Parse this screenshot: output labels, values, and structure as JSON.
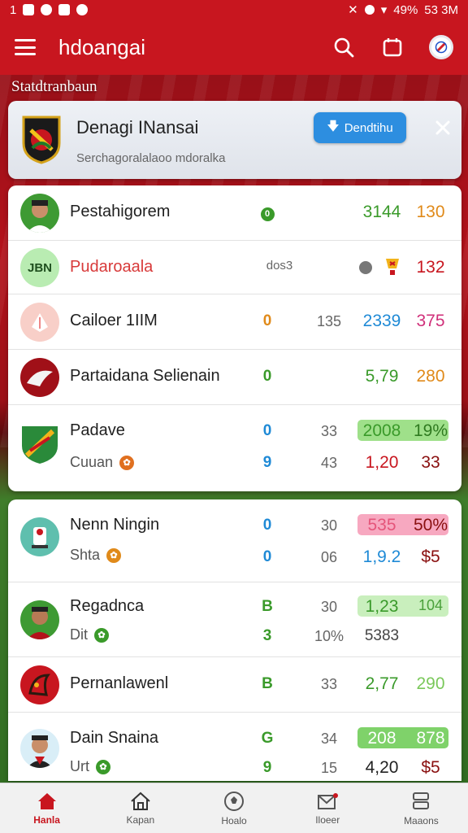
{
  "status_bar": {
    "time": "1",
    "battery": "49%",
    "clock": "53 3M"
  },
  "app": {
    "title": "hdoangai"
  },
  "section_title": "Statdtranbaun",
  "banner": {
    "title": "Denagi INansai",
    "subtitle": "Serchagoralalaoo mdoralka",
    "download_label": "Dendtihu"
  },
  "rows_card1": [
    {
      "name": "Pestahigorem",
      "c1": "0",
      "c3": "3144",
      "c4": "130"
    },
    {
      "avatar_text": "JBN",
      "name": "Pudaroaala",
      "c2": "dos3",
      "c4": "132"
    },
    {
      "name": "Cailoer 1IIM",
      "c1": "0",
      "c2": "135",
      "c3": "2339",
      "c4": "375"
    },
    {
      "name": "Partaidana Selienain",
      "c1": "0",
      "c3": "5,79",
      "c4": "280"
    },
    {
      "name": "Padave",
      "sub": "Cuuan",
      "c1a": "0",
      "c2a": "33",
      "c3a": "2008",
      "c4a": "19%",
      "c1b": "9",
      "c2b": "43",
      "c3b": "1,20",
      "c4b": "33"
    }
  ],
  "rows_card2": [
    {
      "name": "Nenn Ningin",
      "sub": "Shta",
      "c1a": "0",
      "c2a": "30",
      "c3a": "535",
      "c4a": "50%",
      "c1b": "0",
      "c2b": "06",
      "c3b": "1,9.2",
      "c4b": "$5"
    },
    {
      "name": "Regadnca",
      "sub": "Dit",
      "c1a": "B",
      "c2a": "30",
      "c3a": "1,23",
      "c4a": "104",
      "c1b": "3",
      "c2b": "10%",
      "c3b": "5383"
    },
    {
      "name": "Pernanlawenl",
      "c1": "B",
      "c2": "33",
      "c3": "2,77",
      "c4": "290"
    },
    {
      "name": "Dain Snaina",
      "sub": "Urt",
      "c1a": "G",
      "c2a": "34",
      "c3a": "208",
      "c4a": "878",
      "c1b": "9",
      "c2b": "15",
      "c3b": "4,20",
      "c4b": "$5"
    }
  ],
  "bottom_nav": [
    {
      "label": "Hanla",
      "icon": "home-icon",
      "active": true
    },
    {
      "label": "Kapan",
      "icon": "house-outline-icon"
    },
    {
      "label": "Hoalo",
      "icon": "ball-icon"
    },
    {
      "label": "Iloeer",
      "icon": "mail-icon"
    },
    {
      "label": "Maaons",
      "icon": "menu-stack-icon"
    }
  ],
  "colors": {
    "brand_red": "#c8161f",
    "green": "#3a9a2a",
    "blue": "#1f8ad6",
    "orange": "#e08a1a",
    "highlight_green": "#9fe08a",
    "highlight_pink": "#f7a8c0"
  }
}
